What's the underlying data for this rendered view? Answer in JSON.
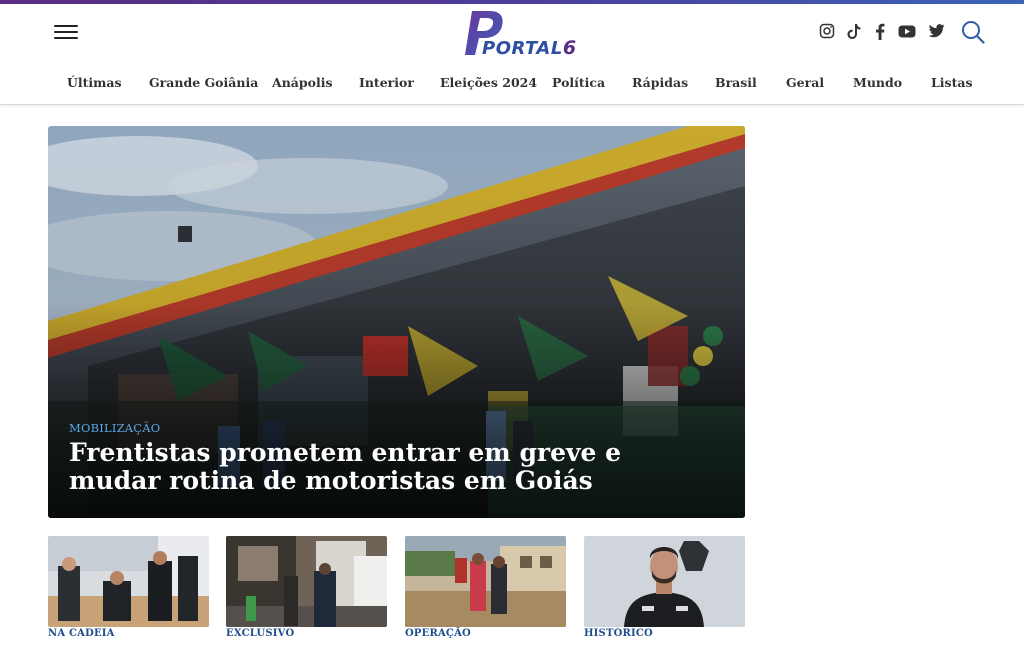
{
  "header": {
    "logo_text": "PORTAL",
    "logo_number": "6",
    "menu_icon": "hamburger-menu-icon",
    "social_icons": [
      "instagram-icon",
      "tiktok-icon",
      "facebook-icon",
      "youtube-icon",
      "twitter-icon"
    ],
    "search_icon": "search-icon",
    "brand_colors": {
      "purple": "#5b2c83",
      "blue": "#2f4fa3"
    }
  },
  "nav": {
    "items": [
      "Últimas",
      "Grande Goiânia",
      "Anápolis",
      "Interior",
      "Eleições 2024",
      "Política",
      "Rápidas",
      "Brasil",
      "Geral",
      "Mundo",
      "Listas"
    ]
  },
  "hero": {
    "category": "MOBILIZAÇÃO",
    "title": "Frentistas prometem entrar em greve e mudar rotina de motoristas em Goiás"
  },
  "cards": [
    {
      "category": "NA CADEIA"
    },
    {
      "category": "EXCLUSIVO"
    },
    {
      "category": "OPERAÇÃO"
    },
    {
      "category": "HISTÓRICO"
    }
  ],
  "colors": {
    "category_blue": "#1f4e8c",
    "hero_tag_blue": "#5aa7e6"
  }
}
